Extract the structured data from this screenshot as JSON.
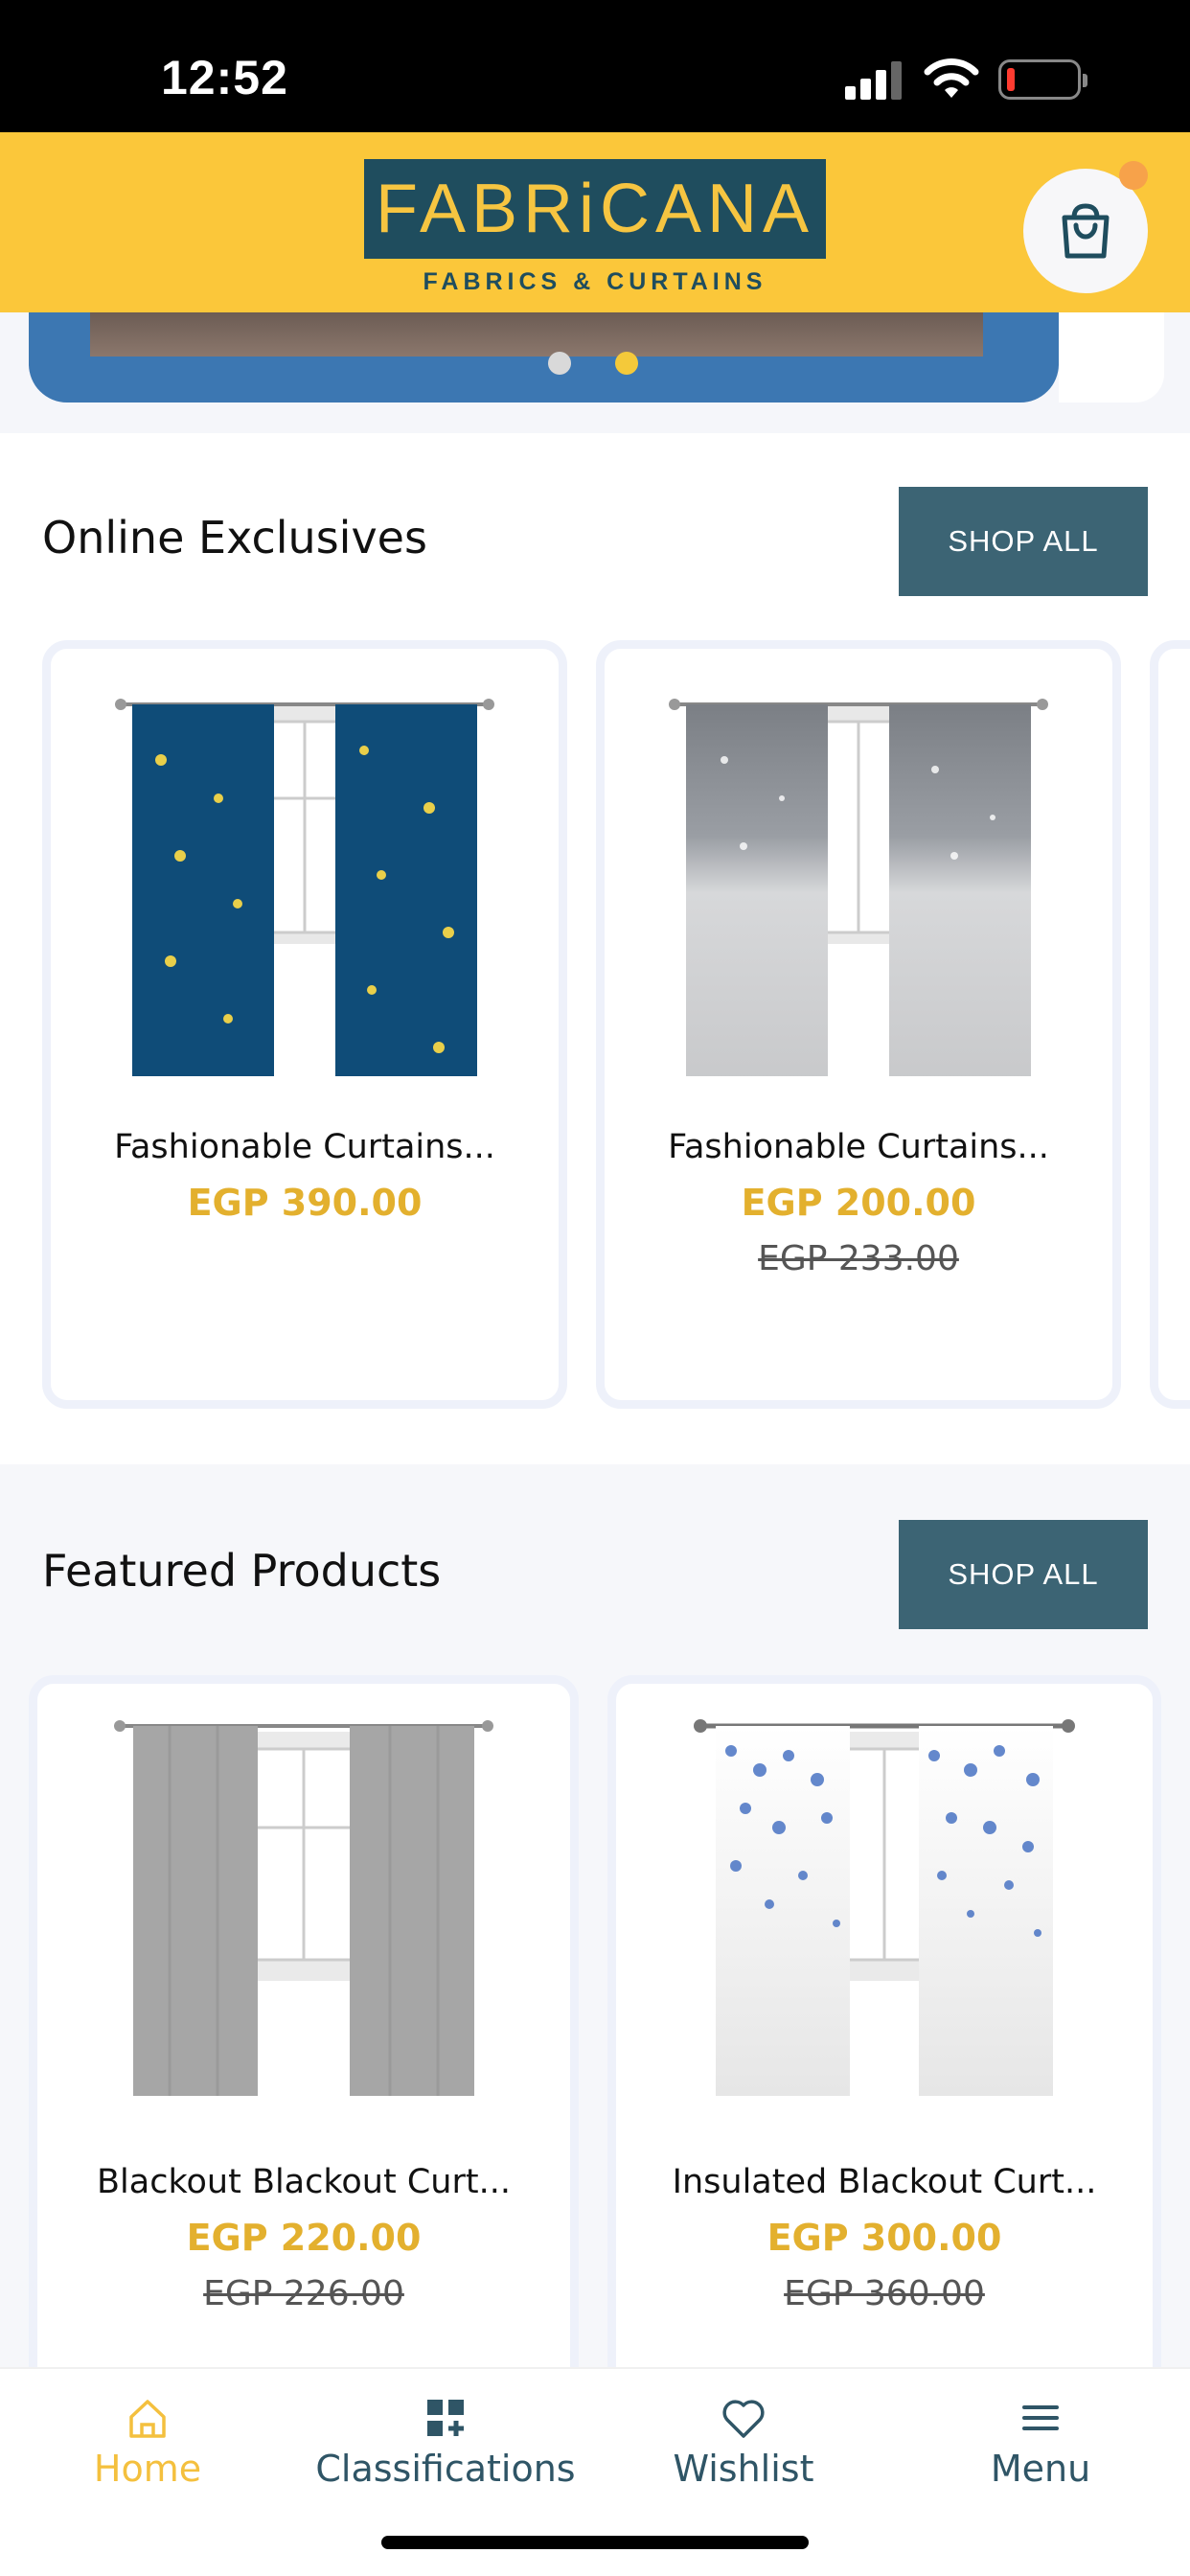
{
  "status_bar": {
    "time": "12:52"
  },
  "header": {
    "logo_text": "FABRiCANA",
    "logo_subtitle": "FABRICS & CURTAINS",
    "cart_icon": "shopping-bag-icon"
  },
  "banner": {
    "dots": 2,
    "active_dot": 1
  },
  "sections": [
    {
      "title": "Online Exclusives",
      "shop_all": "SHOP ALL",
      "products": [
        {
          "name": "Fashionable Curtains...",
          "price": "EGP 390.00",
          "old_price": ""
        },
        {
          "name": "Fashionable Curtains...",
          "price": "EGP 200.00",
          "old_price": "EGP 233.00"
        }
      ]
    },
    {
      "title": "Featured Products",
      "shop_all": "SHOP ALL",
      "products": [
        {
          "name": "Blackout Blackout Curt...",
          "price": "EGP 220.00",
          "old_price": "EGP 226.00"
        },
        {
          "name": "Insulated Blackout Curt...",
          "price": "EGP 300.00",
          "old_price": "EGP 360.00"
        }
      ]
    }
  ],
  "bottom_nav": [
    {
      "label": "Home",
      "icon": "home-icon",
      "active": true
    },
    {
      "label": "Classifications",
      "icon": "grid-plus-icon",
      "active": false
    },
    {
      "label": "Wishlist",
      "icon": "heart-icon",
      "active": false
    },
    {
      "label": "Menu",
      "icon": "hamburger-menu-icon",
      "active": false
    }
  ],
  "colors": {
    "header_bg": "#fbc73a",
    "logo_bg": "#1f4d5e",
    "button_bg": "#3c6474",
    "price": "#e3b02e",
    "active_nav": "#f4c03e"
  }
}
